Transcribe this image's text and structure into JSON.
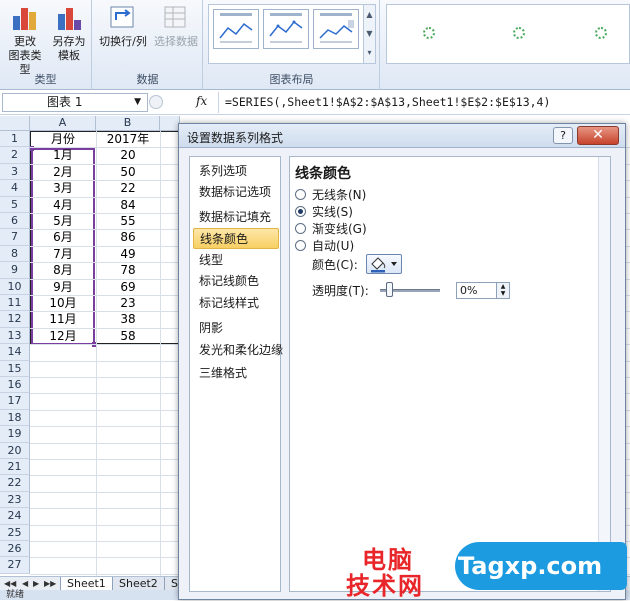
{
  "ribbon": {
    "buttons": {
      "change_type": [
        "更改",
        "图表类型"
      ],
      "save_template": [
        "另存为",
        "模板"
      ],
      "switch_row_col": "切换行/列",
      "select_data": "选择数据"
    },
    "groups": {
      "type": "类型",
      "data": "数据",
      "layout": "图表布局"
    }
  },
  "formula_bar": {
    "name_box": "图表 1",
    "fx": "fx",
    "formula": "=SERIES(,Sheet1!$A$2:$A$13,Sheet1!$E$2:$E$13,4)"
  },
  "sheet": {
    "columns": [
      "A",
      "B"
    ],
    "rows": [
      "1",
      "2",
      "3",
      "4",
      "5",
      "6",
      "7",
      "8",
      "9",
      "10",
      "11",
      "12",
      "13",
      "14",
      "15",
      "16",
      "17",
      "18",
      "19",
      "20",
      "21",
      "22",
      "23",
      "24",
      "25",
      "26",
      "27"
    ],
    "header_row": {
      "a": "月份",
      "b": "2017年"
    },
    "data": [
      {
        "month": "1月",
        "value": "20"
      },
      {
        "month": "2月",
        "value": "50"
      },
      {
        "month": "3月",
        "value": "22"
      },
      {
        "month": "4月",
        "value": "84"
      },
      {
        "month": "5月",
        "value": "55"
      },
      {
        "month": "6月",
        "value": "86"
      },
      {
        "month": "7月",
        "value": "49"
      },
      {
        "month": "8月",
        "value": "78"
      },
      {
        "month": "9月",
        "value": "69"
      },
      {
        "month": "10月",
        "value": "23"
      },
      {
        "month": "11月",
        "value": "38"
      },
      {
        "month": "12月",
        "value": "58"
      }
    ],
    "tabs": [
      "Sheet1",
      "Sheet2",
      "S"
    ],
    "status": "就绪"
  },
  "dialog": {
    "title": "设置数据系列格式",
    "help": "?",
    "close": "✕",
    "nav": [
      "系列选项",
      "数据标记选项",
      "数据标记填充",
      "线条颜色",
      "线型",
      "标记线颜色",
      "标记线样式",
      "阴影",
      "发光和柔化边缘",
      "三维格式"
    ],
    "active_nav": 3,
    "section_title": "线条颜色",
    "options": [
      "无线条(N)",
      "实线(S)",
      "渐变线(G)",
      "自动(U)"
    ],
    "selected_option": 1,
    "color_label": "颜色(C):",
    "transparency_label": "透明度(T):",
    "transparency_value": "0%"
  },
  "watermark": {
    "cn_top": "电脑",
    "cn_bottom": "技术网",
    "site": "Tagxp.com"
  },
  "colors": {
    "accent": "#f7cf63",
    "selection": "#7a3f9e",
    "watermark_red": "#e8262a",
    "watermark_blue": "#1d9be0"
  }
}
